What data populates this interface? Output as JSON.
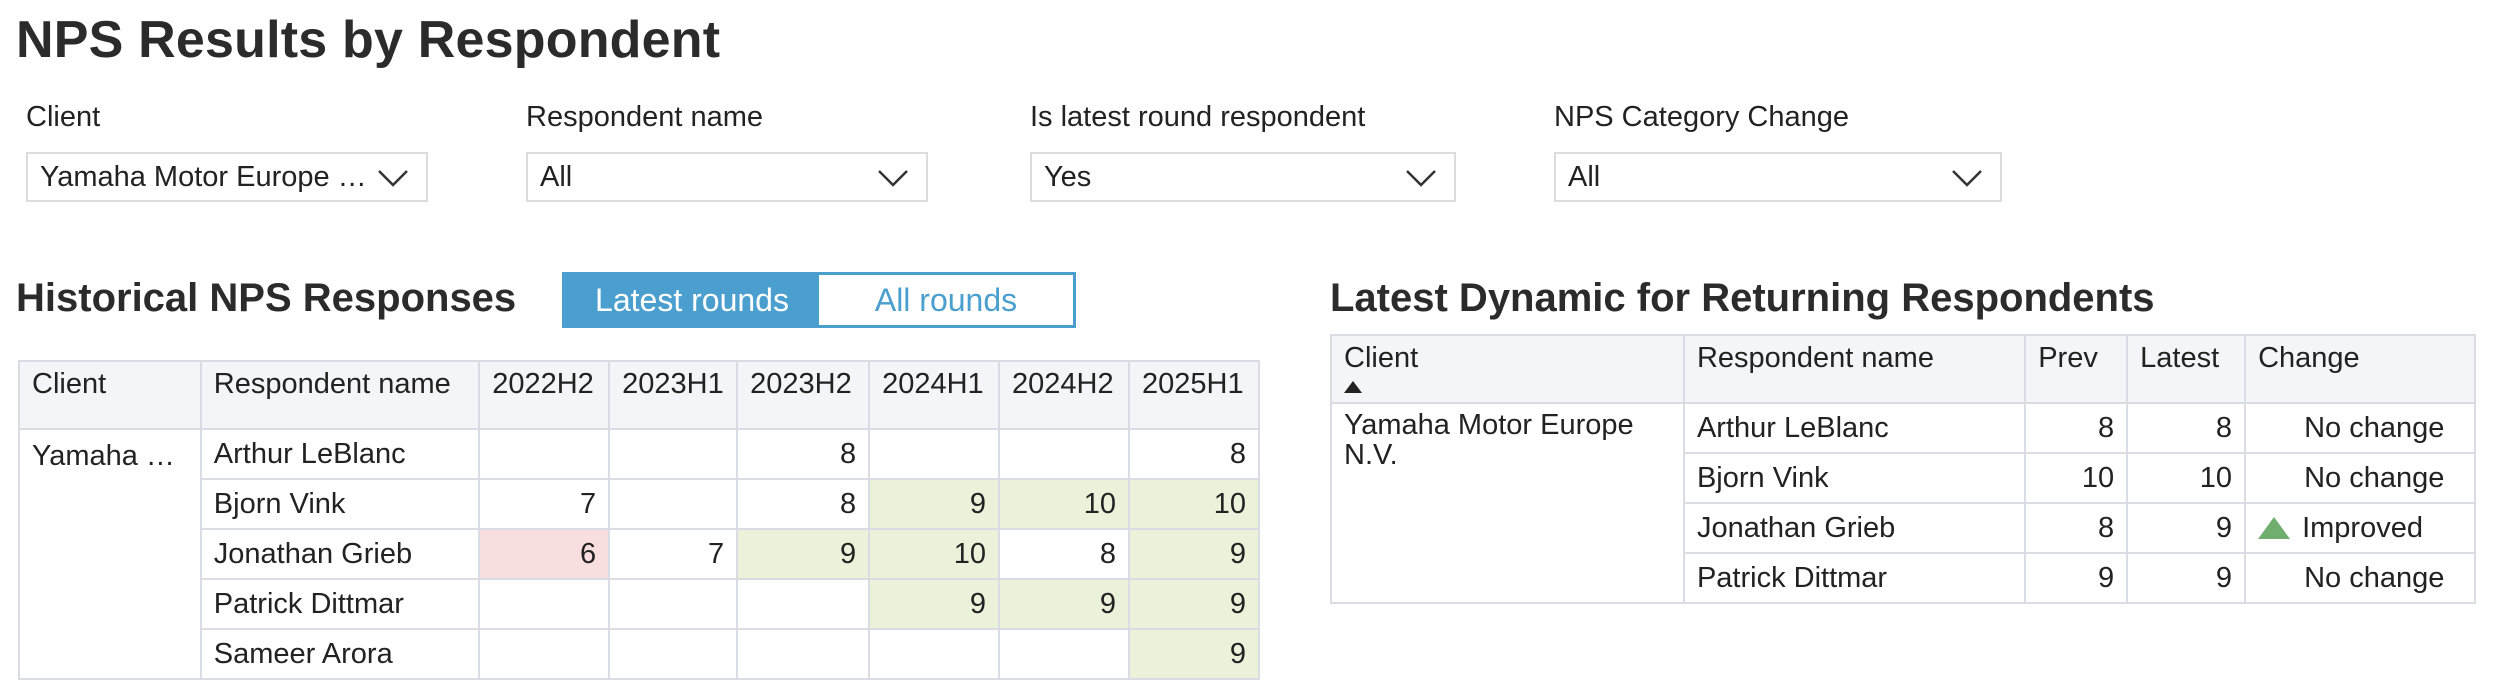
{
  "page": {
    "title": "NPS Results by Respondent"
  },
  "filters": [
    {
      "label": "Client",
      "value": "Yamaha Motor Europe …"
    },
    {
      "label": "Respondent name",
      "value": "All"
    },
    {
      "label": "Is latest round respondent",
      "value": "Yes"
    },
    {
      "label": "NPS Category Change",
      "value": "All"
    }
  ],
  "historical": {
    "title": "Historical NPS Responses",
    "toggle": {
      "active": "Latest rounds",
      "inactive": "All rounds"
    },
    "headers": [
      "Client",
      "Respondent name",
      "2022H2",
      "2023H1",
      "2023H2",
      "2024H1",
      "2024H2",
      "2025H1"
    ],
    "client": "Yamaha …",
    "rows": [
      {
        "name": "Arthur LeBlanc",
        "cells": [
          "",
          "",
          "8",
          "",
          "",
          "8"
        ]
      },
      {
        "name": "Bjorn Vink",
        "cells": [
          "7",
          "",
          "8",
          "9",
          "10",
          "10"
        ]
      },
      {
        "name": "Jonathan Grieb",
        "cells": [
          "6",
          "7",
          "9",
          "10",
          "8",
          "9"
        ]
      },
      {
        "name": "Patrick Dittmar",
        "cells": [
          "",
          "",
          "",
          "9",
          "9",
          "9"
        ]
      },
      {
        "name": "Sameer Arora",
        "cells": [
          "",
          "",
          "",
          "",
          "",
          "9"
        ]
      }
    ],
    "highlight_colors": {
      "detractor": "#f8dede",
      "promoter": "#ebf2da"
    }
  },
  "dynamic": {
    "title": "Latest Dynamic for Returning Respondents",
    "headers": [
      "Client",
      "Respondent name",
      "Prev",
      "Latest",
      "Change"
    ],
    "client": "Yamaha Motor Europe N.V.",
    "rows": [
      {
        "name": "Arthur LeBlanc",
        "prev": "8",
        "latest": "8",
        "change": "No change"
      },
      {
        "name": "Bjorn Vink",
        "prev": "10",
        "latest": "10",
        "change": "No change"
      },
      {
        "name": "Jonathan Grieb",
        "prev": "8",
        "latest": "9",
        "change": "Improved",
        "icon": "triangle-up-icon"
      },
      {
        "name": "Patrick Dittmar",
        "prev": "9",
        "latest": "9",
        "change": "No change"
      }
    ]
  }
}
